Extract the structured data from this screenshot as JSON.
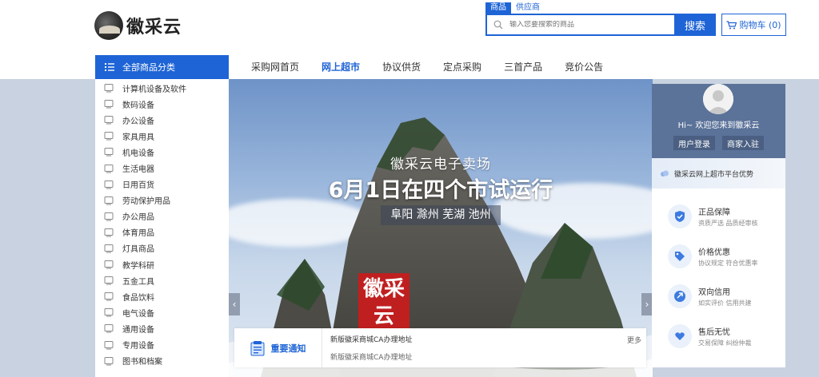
{
  "header": {
    "logo_text": "徽采云",
    "search_tabs": [
      "商品",
      "供应商"
    ],
    "search_placeholder": "输入您要搜索的商品",
    "search_button": "搜索",
    "cart_label": "购物车 (0)"
  },
  "nav": {
    "category_header": "全部商品分类",
    "items": [
      "采购网首页",
      "网上超市",
      "协议供货",
      "定点采购",
      "三首产品",
      "竞价公告"
    ],
    "active_index": 1
  },
  "categories": [
    "计算机设备及软件",
    "数码设备",
    "办公设备",
    "家具用具",
    "机电设备",
    "生活电器",
    "日用百货",
    "劳动保护用品",
    "办公用品",
    "体育用品",
    "灯具商品",
    "教学科研",
    "五金工具",
    "食品饮料",
    "电气设备",
    "通用设备",
    "专用设备",
    "图书和档案"
  ],
  "banner": {
    "subtitle": "徽采云电子卖场",
    "title": "6月1日在四个市试运行",
    "cities": "阜阳 滁州 芜湖 池州",
    "seal_text": "徽采云",
    "prev_arrow": "‹",
    "next_arrow": "›"
  },
  "notice": {
    "title": "重要通知",
    "line1": "新版徽采商城CA办理地址",
    "line2": "新版徽采商城CA办理地址",
    "more": "更多"
  },
  "user": {
    "greeting": "Hi~ 欢迎您来到徽采云",
    "login": "用户登录",
    "merchant": "商家入驻"
  },
  "advantages": {
    "header": "徽采云网上超市平台优势",
    "items": [
      {
        "title": "正品保障",
        "desc": "资质严选 品质经审核"
      },
      {
        "title": "价格优惠",
        "desc": "协议规定 符合优惠率"
      },
      {
        "title": "双向信用",
        "desc": "如实评价 信用共建"
      },
      {
        "title": "售后无忧",
        "desc": "交易保障 纠纷仲裁"
      }
    ]
  },
  "colors": {
    "primary": "#1e64d6",
    "panel": "#5b7299"
  }
}
